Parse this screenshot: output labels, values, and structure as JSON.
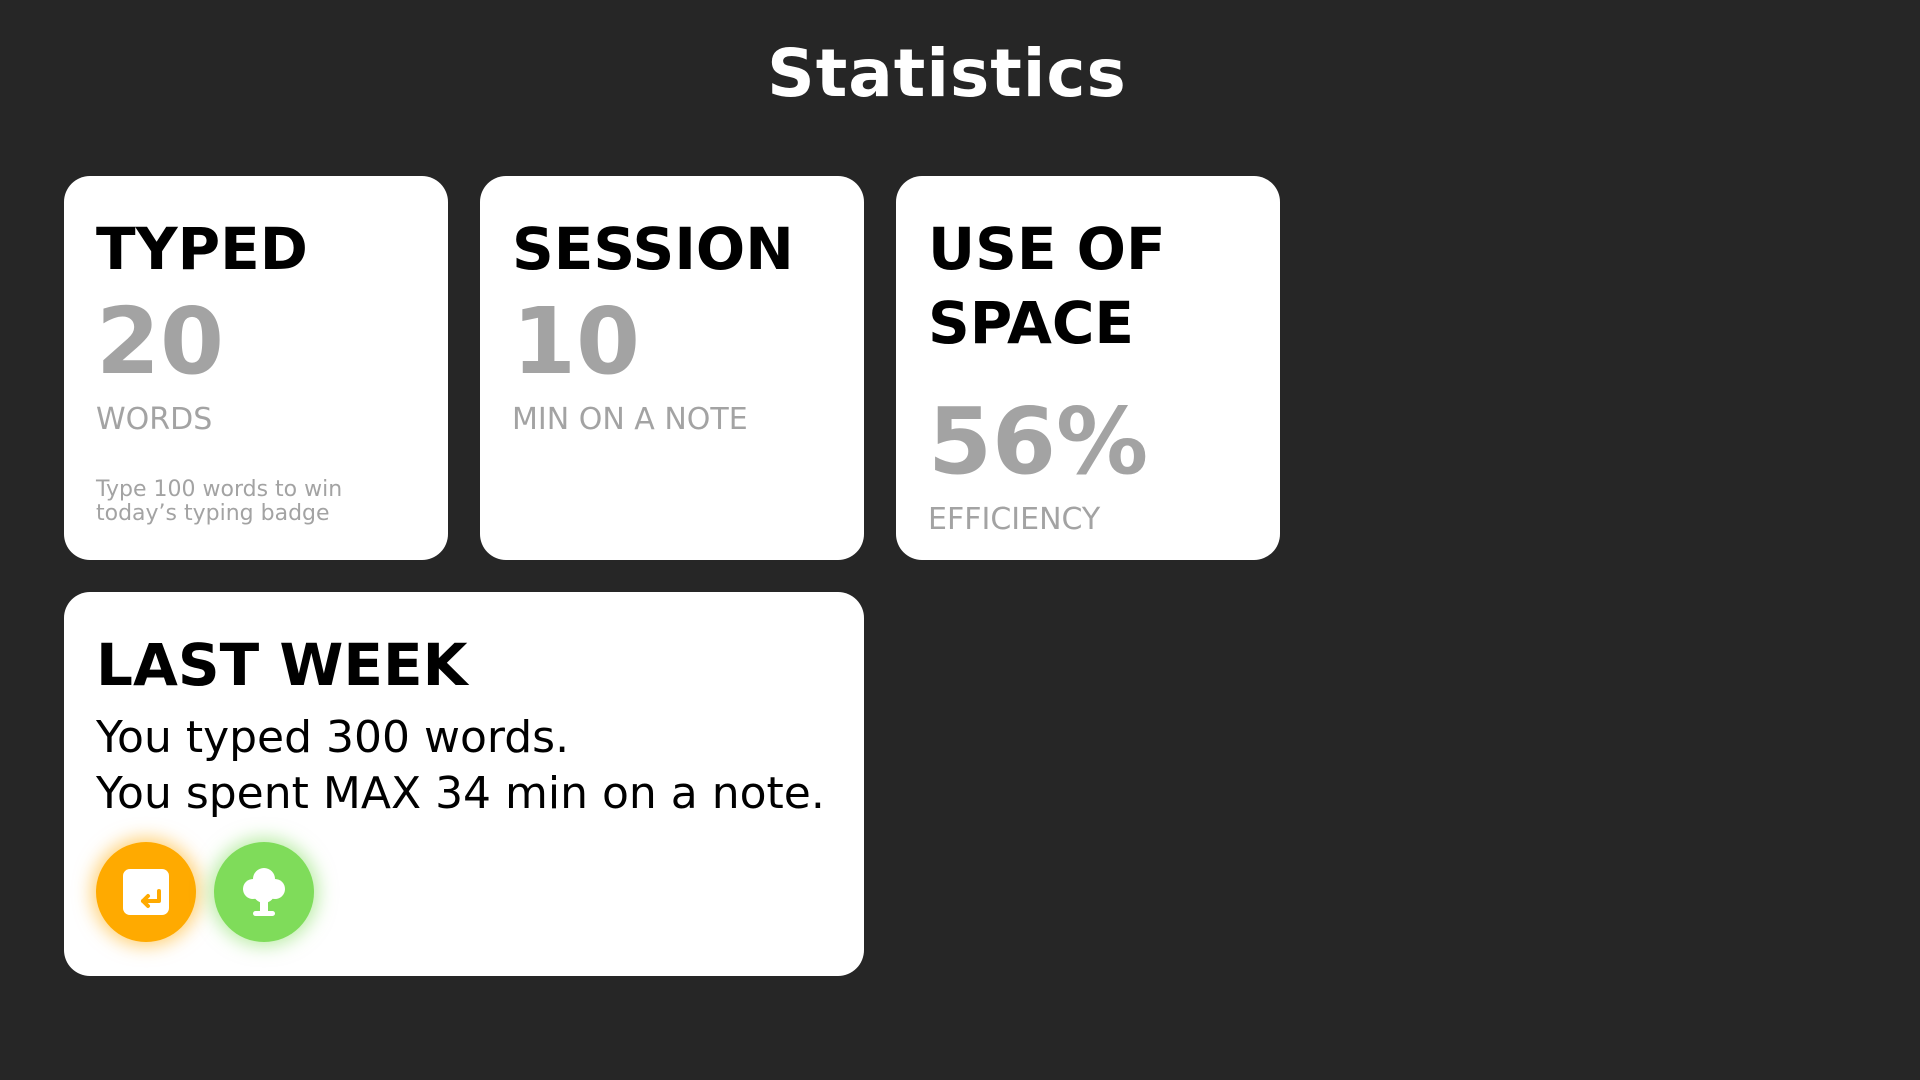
{
  "header": {
    "title": "Statistics"
  },
  "cards": {
    "typed": {
      "title": "TYPED",
      "value": "20",
      "unit": "WORDS",
      "hint": "Type 100 words to win today’s typing badge"
    },
    "session": {
      "title": "SESSION",
      "value": "10",
      "unit": "MIN ON A NOTE"
    },
    "space": {
      "title": "USE OF\nSPACE",
      "value": "56%",
      "unit": "EFFICIENCY"
    }
  },
  "last_week": {
    "title": "LAST WEEK",
    "line1": "You typed 300 words.",
    "line2": "You spent MAX 34 min on a note.",
    "badges": [
      {
        "icon": "typing-badge-icon",
        "color": "#ffaa00"
      },
      {
        "icon": "tree-badge-icon",
        "color": "#7fdc5a"
      }
    ]
  },
  "colors": {
    "background": "#262626",
    "card": "#ffffff",
    "muted": "#a3a3a3"
  }
}
